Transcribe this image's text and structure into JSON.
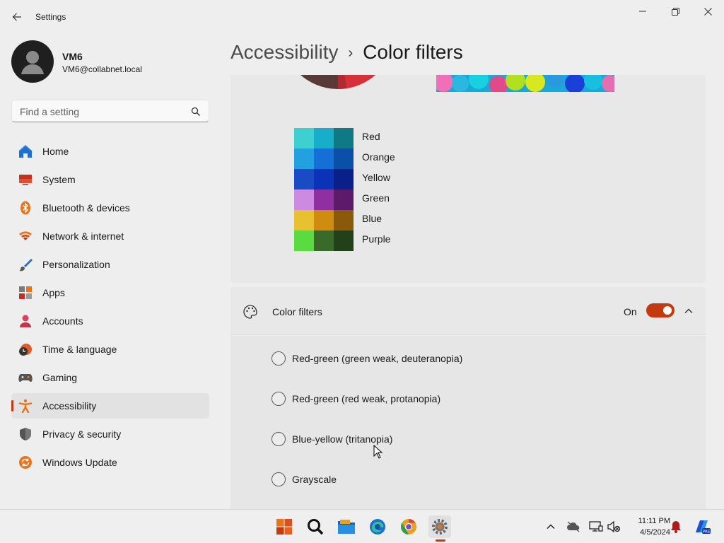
{
  "window": {
    "title": "Settings"
  },
  "profile": {
    "name": "VM6",
    "email": "VM6@collabnet.local"
  },
  "search": {
    "placeholder": "Find a setting"
  },
  "sidebar": {
    "items": [
      {
        "label": "Home",
        "icon": "home-icon"
      },
      {
        "label": "System",
        "icon": "system-icon"
      },
      {
        "label": "Bluetooth & devices",
        "icon": "bluetooth-icon"
      },
      {
        "label": "Network & internet",
        "icon": "wifi-icon"
      },
      {
        "label": "Personalization",
        "icon": "brush-icon"
      },
      {
        "label": "Apps",
        "icon": "apps-icon"
      },
      {
        "label": "Accounts",
        "icon": "accounts-icon"
      },
      {
        "label": "Time & language",
        "icon": "clock-globe-icon"
      },
      {
        "label": "Gaming",
        "icon": "gamepad-icon"
      },
      {
        "label": "Accessibility",
        "icon": "accessibility-icon",
        "selected": true
      },
      {
        "label": "Privacy & security",
        "icon": "shield-icon"
      },
      {
        "label": "Windows Update",
        "icon": "update-icon"
      }
    ]
  },
  "breadcrumb": {
    "parent": "Accessibility",
    "separator": "›",
    "current": "Color filters"
  },
  "preview": {
    "swatch_labels": [
      "Red",
      "Orange",
      "Yellow",
      "Green",
      "Blue",
      "Purple"
    ],
    "swatch_colors": [
      [
        "#3ecfd0",
        "#17aecb",
        "#0f7a86"
      ],
      [
        "#22a0e0",
        "#146fd6",
        "#0a4fa8"
      ],
      [
        "#1a4bc4",
        "#0b33b8",
        "#0a1f8a"
      ],
      [
        "#cc8ae0",
        "#8f2fa0",
        "#5e1a6a"
      ],
      [
        "#e8c030",
        "#d08c10",
        "#8a5a0a"
      ],
      [
        "#5adc40",
        "#3a6a2a",
        "#22401a"
      ]
    ]
  },
  "color_filters": {
    "title": "Color filters",
    "state_label": "On",
    "enabled": true,
    "options": [
      "Red-green (green weak, deuteranopia)",
      "Red-green (red weak, protanopia)",
      "Blue-yellow (tritanopia)",
      "Grayscale"
    ]
  },
  "taskbar": {
    "apps": [
      "start-icon",
      "search-icon",
      "file-explorer-icon",
      "edge-icon",
      "chrome-icon",
      "settings-icon"
    ],
    "active_app": "settings-icon"
  },
  "clock": {
    "time": "11:11 PM",
    "date": "4/5/2024"
  },
  "colors": {
    "accent": "#c23a0d",
    "background": "#eeeeee",
    "card": "#e8e8e8"
  }
}
